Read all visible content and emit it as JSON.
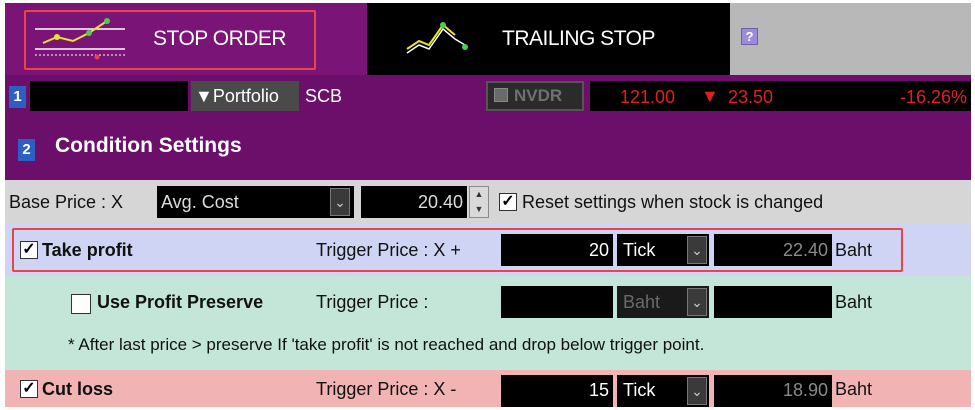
{
  "tabs": {
    "stop_order": "STOP ORDER",
    "trailing_stop": "TRAILING STOP",
    "help": "?"
  },
  "symbol_bar": {
    "section_number": "1",
    "portfolio_label": "▼Portfolio",
    "portfolio_name": "SCB",
    "nvdr_label": "NVDR",
    "last_price": "121.00",
    "change_arrow": "▼",
    "change": "23.50",
    "change_pct": "-16.26%",
    "quote_color": "#e02020"
  },
  "condition": {
    "section_number": "2",
    "title": "Condition Settings"
  },
  "base_price": {
    "label": "Base Price : X",
    "selected": "Avg. Cost",
    "value": "20.40",
    "reset_label": "Reset settings when stock is changed",
    "reset_checked": true
  },
  "take_profit": {
    "label": "Take profit",
    "checked": true,
    "trigger_label": "Trigger Price : X +",
    "offset": "20",
    "unit": "Tick",
    "result": "22.40",
    "currency": "Baht"
  },
  "profit_preserve": {
    "label": "Use Profit Preserve",
    "checked": false,
    "trigger_label": "Trigger Price :",
    "unit": "Baht",
    "currency": "Baht",
    "note": "* After last price > preserve If 'take profit' is not reached and drop below trigger point."
  },
  "cut_loss": {
    "label": "Cut loss",
    "checked": true,
    "trigger_label": "Trigger Price : X -",
    "offset": "15",
    "unit": "Tick",
    "result": "18.90",
    "currency": "Baht"
  },
  "colors": {
    "accent_purple": "#6c0f6a",
    "highlight_red": "#e84545",
    "take_profit_bg": "#cfd4f5",
    "preserve_bg": "#c3e6d8",
    "cut_loss_bg": "#f1b3b3"
  }
}
